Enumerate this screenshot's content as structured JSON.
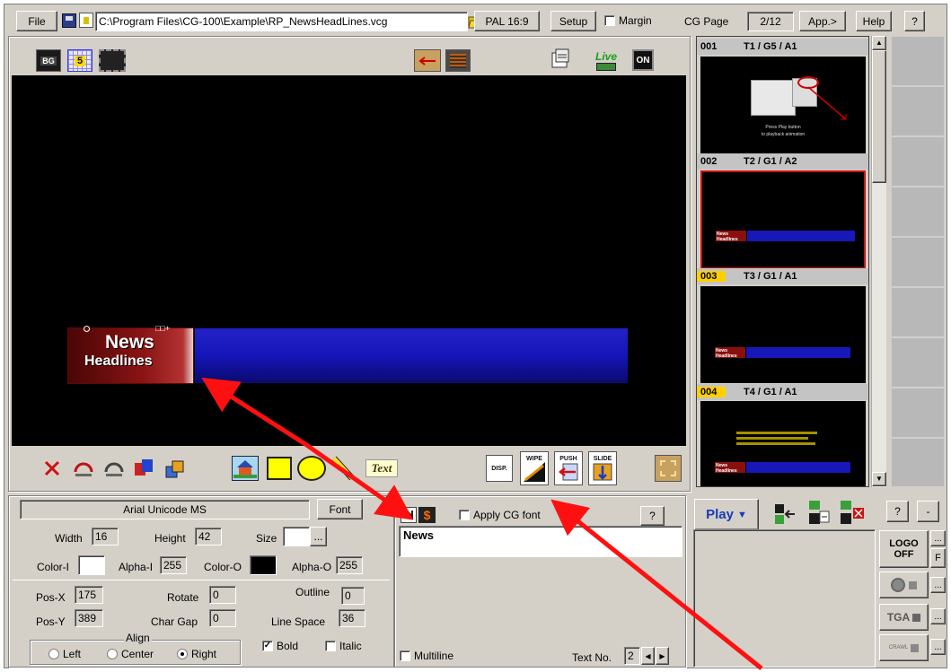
{
  "toolbar": {
    "file_label": "File",
    "path_value": "C:\\Program Files\\CG-100\\Example\\RP_NewsHeadLines.vcg",
    "format_label": "PAL 16:9",
    "setup_label": "Setup",
    "margin_label": "Margin",
    "cg_page_label": "CG Page",
    "cg_page_value": "2/12",
    "app_label": "App.>",
    "help_label": "Help",
    "question_label": "?"
  },
  "preview_toolbar": {
    "bg_icon_text": "BG",
    "grid_icon_text": "5",
    "live_icon_text": "Live",
    "on_icon_text": "ON"
  },
  "preview": {
    "title_line1": "News",
    "title_line2": "Headlines"
  },
  "bottom_tools": {
    "text_tool_label": "Text",
    "disp_label": "DISP.",
    "wipe_label": "WIPE",
    "push_label": "PUSH",
    "slide_label": "SLIDE"
  },
  "pages": [
    {
      "num": "001",
      "code": "T1 / G5 / A1",
      "highlight": false,
      "selected": false,
      "caption_1": "Press Play button",
      "caption_2": "to playback animation"
    },
    {
      "num": "002",
      "code": "T2 / G1 / A2",
      "highlight": false,
      "selected": true,
      "mini": "News Headlines"
    },
    {
      "num": "003",
      "code": "T3 / G1 / A1",
      "highlight": true,
      "selected": false,
      "mini": "News Headlines"
    },
    {
      "num": "004",
      "code": "T4 / G1 / A1",
      "highlight": true,
      "selected": false,
      "mini": "News Headlines"
    }
  ],
  "font_panel": {
    "font_name": "Arial Unicode MS",
    "font_button": "Font",
    "width_label": "Width",
    "width_value": "16",
    "height_label": "Height",
    "height_value": "42",
    "size_label": "Size",
    "size_button": "...",
    "color_i_label": "Color-I",
    "color_i": "#ffffff",
    "alpha_i_label": "Alpha-I",
    "alpha_i_value": "255",
    "color_o_label": "Color-O",
    "color_o": "#000000",
    "alpha_o_label": "Alpha-O",
    "alpha_o_value": "255",
    "pos_x_label": "Pos-X",
    "pos_x_value": "175",
    "rotate_label": "Rotate",
    "rotate_value": "0",
    "outline_label": "Outline",
    "outline_value": "0",
    "pos_y_label": "Pos-Y",
    "pos_y_value": "389",
    "char_gap_label": "Char Gap",
    "char_gap_value": "0",
    "line_space_label": "Line Space",
    "line_space_value": "36",
    "align_label": "Align",
    "align_left": "Left",
    "align_center": "Center",
    "align_right": "Right",
    "align_selected": "Right",
    "bold_label": "Bold",
    "bold_checked": true,
    "italic_label": "Italic",
    "italic_checked": false
  },
  "text_panel": {
    "apply_cg_font_label": "Apply CG font",
    "help_label": "?",
    "text_value": "News",
    "multiline_label": "Multiline",
    "text_no_label": "Text No.",
    "text_no_value": "2"
  },
  "play_panel": {
    "play_label": "Play",
    "help_label": "?",
    "minus_label": "-",
    "logo_label_1": "LOGO",
    "logo_label_2": "OFF",
    "f_label": "F",
    "more_label": "...",
    "tga_label": "TGA",
    "crawl_label": "CRAWL"
  }
}
